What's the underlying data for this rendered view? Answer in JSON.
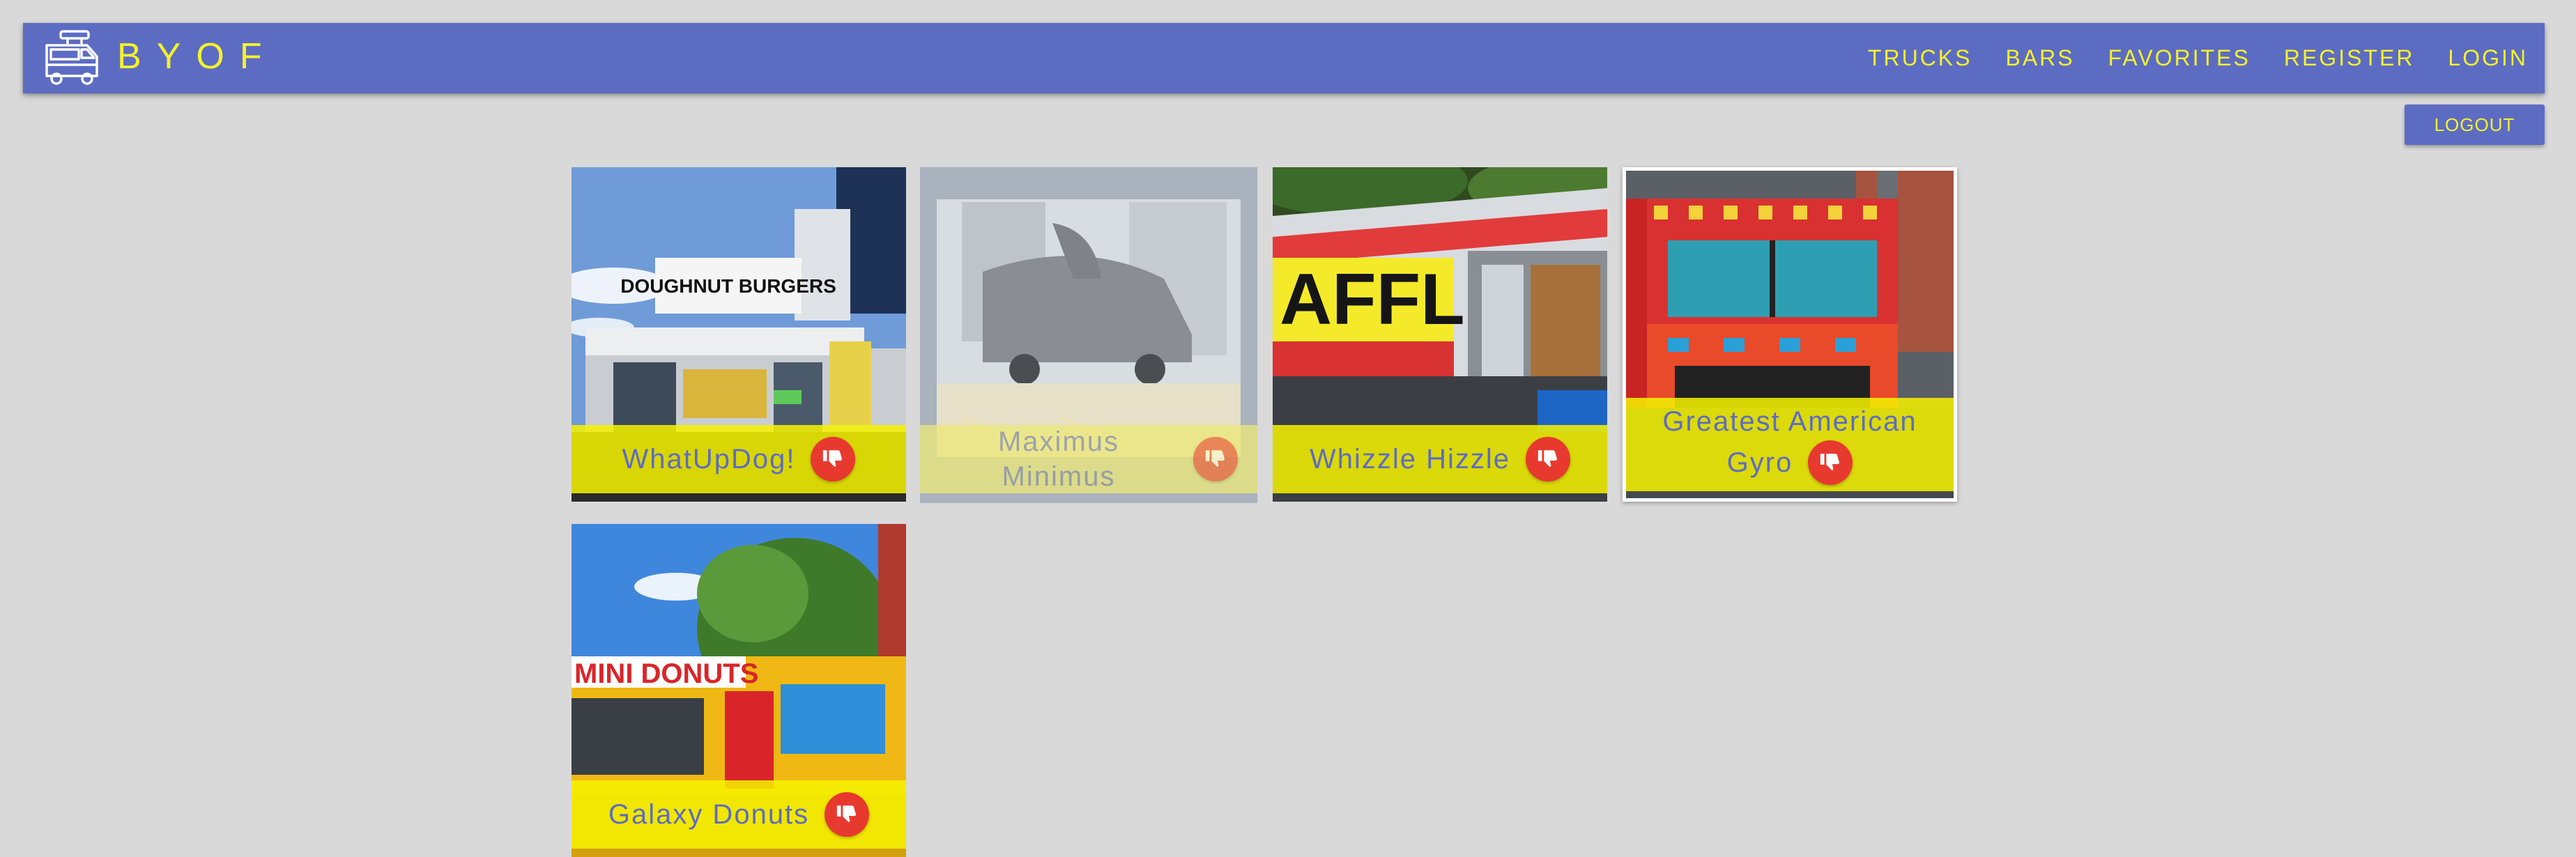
{
  "brand": {
    "title": "BYOF",
    "logo_icon": "food-truck-icon"
  },
  "nav": {
    "links": [
      "TRUCKS",
      "BARS",
      "FAVORITES",
      "REGISTER",
      "LOGIN"
    ]
  },
  "logout_label": "LOGOUT",
  "colors": {
    "primary": "#5d6cc3",
    "accent_yellow": "#f4f22a",
    "caption_yellow": "#f6f200",
    "dislike_red": "#e8392f",
    "background": "#d9d9d9"
  },
  "trucks": [
    {
      "name": "WhatUpDog!",
      "photo_sign": "DOUGHNUT BURGERS",
      "state": "normal",
      "action_icon": "thumbs-down-icon"
    },
    {
      "name": "Maximus Minimus",
      "state": "faded",
      "action_icon": "thumbs-down-icon"
    },
    {
      "name": "Whizzle Hizzle",
      "photo_sign": "AFFLE",
      "state": "normal",
      "action_icon": "thumbs-down-icon"
    },
    {
      "name_line1": "Greatest American",
      "name_line2": "Gyro",
      "state": "selected",
      "action_icon": "thumbs-down-icon"
    },
    {
      "name": "Galaxy Donuts",
      "photo_sign": "MINI DONUTS",
      "state": "normal",
      "action_icon": "thumbs-down-icon"
    }
  ]
}
